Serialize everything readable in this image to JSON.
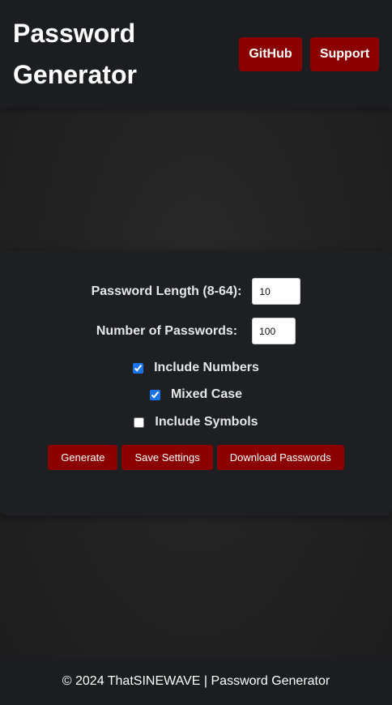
{
  "header": {
    "title": "Password Generator",
    "nav": {
      "github_label": "GitHub",
      "support_label": "Support"
    }
  },
  "form": {
    "length": {
      "label": "Password Length (8-64):",
      "value": "10"
    },
    "count": {
      "label": "Number of Passwords:",
      "value": "100"
    },
    "options": {
      "numbers": {
        "label": "Include Numbers",
        "checked": true
      },
      "mixed_case": {
        "label": "Mixed Case",
        "checked": true
      },
      "symbols": {
        "label": "Include Symbols",
        "checked": false
      }
    },
    "buttons": {
      "generate": "Generate",
      "save": "Save Settings",
      "download": "Download Passwords"
    }
  },
  "footer": {
    "text": "© 2024 ThatSINEWAVE | Password Generator"
  },
  "colors": {
    "accent": "#8b0000",
    "header_bg": "#1c1d20",
    "panel_bg": "#1e1f22",
    "checkbox": "#1a73e8"
  }
}
